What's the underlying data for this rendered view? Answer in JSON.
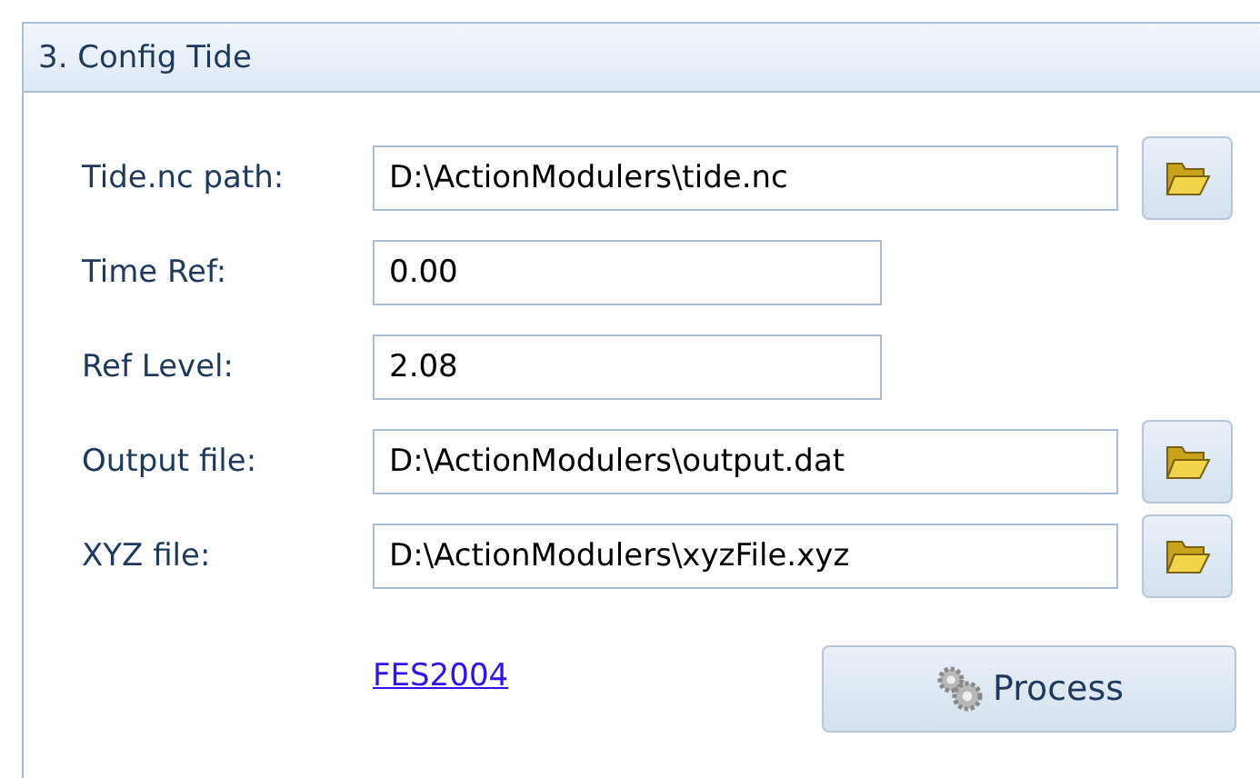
{
  "panel": {
    "title": "3. Config Tide"
  },
  "fields": [
    {
      "kind": "file",
      "label": "Tide.nc path:",
      "value": "D:\\ActionModulers\\tide.nc"
    },
    {
      "kind": "text",
      "label": "Time Ref:",
      "value": "0.00"
    },
    {
      "kind": "text",
      "label": "Ref Level:",
      "value": "2.08"
    },
    {
      "kind": "file",
      "label": "Output file:",
      "value": "D:\\ActionModulers\\output.dat"
    },
    {
      "kind": "file",
      "label": "XYZ file:",
      "value": "D:\\ActionModulers\\xyzFile.xyz"
    }
  ],
  "link": "FES2004",
  "process_button": "Process"
}
